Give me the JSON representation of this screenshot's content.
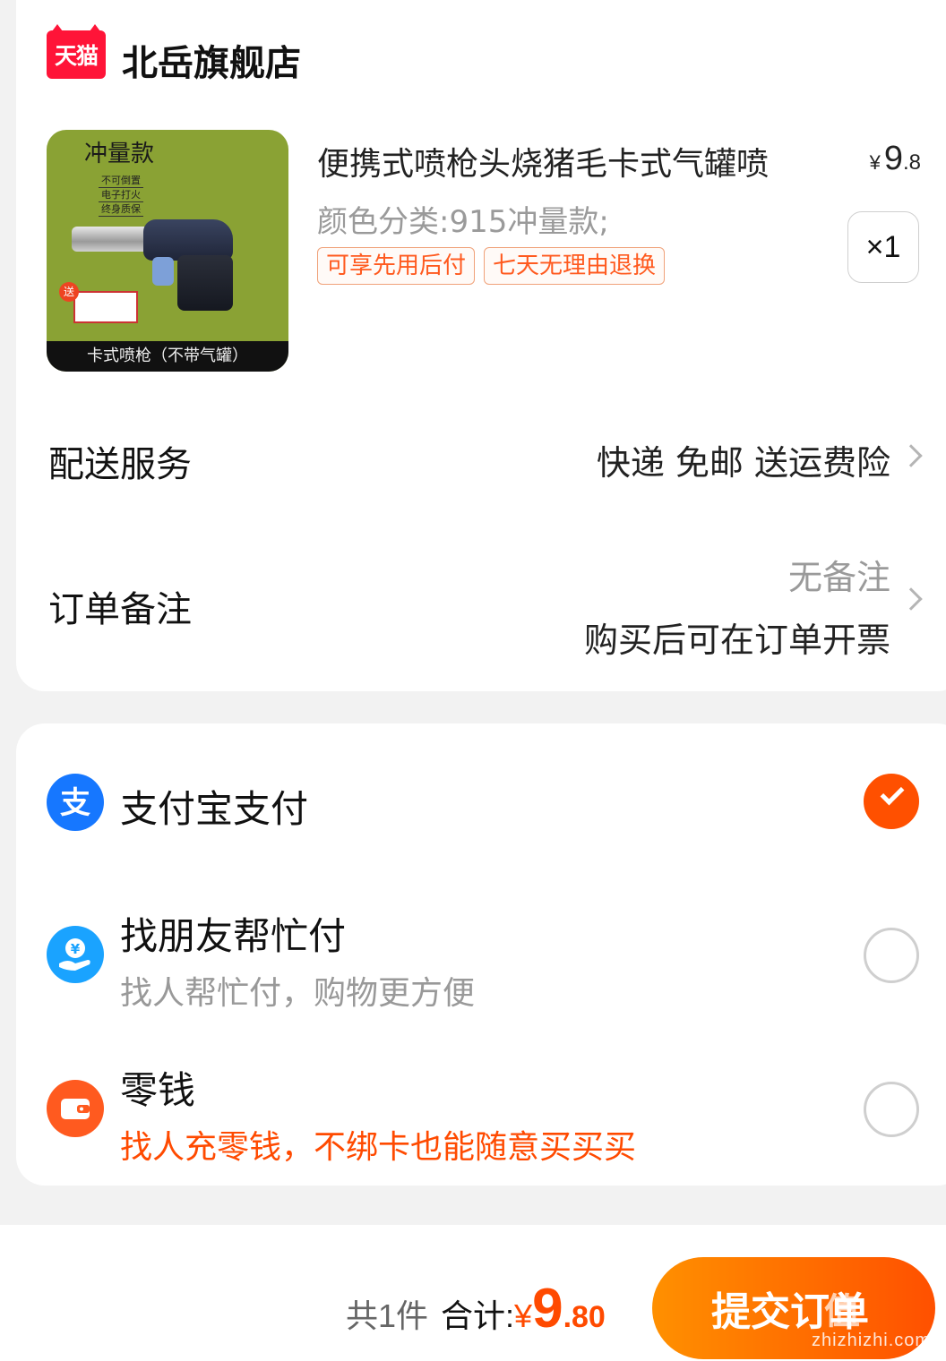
{
  "store": {
    "badge": "天猫",
    "name": "北岳旗舰店"
  },
  "product": {
    "image": {
      "title": "冲量款",
      "notes": [
        "不可倒置",
        "电子打火",
        "终身质保"
      ],
      "gift_tag": "送",
      "caption": "卡式喷枪（不带气罐）"
    },
    "title": "便携式喷枪头烧猪毛卡式气罐喷",
    "price_currency": "¥",
    "price_int": "9",
    "price_dec": ".8",
    "spec": "颜色分类:915冲量款;",
    "tags": [
      "可享先用后付",
      "七天无理由退换"
    ],
    "quantity": "×1"
  },
  "delivery": {
    "label": "配送服务",
    "value": "快递 免邮 送运费险"
  },
  "remark": {
    "label": "订单备注",
    "value": "无备注",
    "sub": "购买后可在订单开票"
  },
  "payment": {
    "options": [
      {
        "title": "支付宝支付",
        "sub": "",
        "icon": "alipay-icon",
        "color": "#1677ff",
        "selected": true
      },
      {
        "title": "找朋友帮忙付",
        "sub": "找人帮忙付，购物更方便",
        "icon": "friend-pay-icon",
        "color": "#1aa3ff",
        "selected": false
      },
      {
        "title": "零钱",
        "sub": "找人充零钱，不绑卡也能随意买买买",
        "icon": "wallet-icon",
        "color": "#ff5a1f",
        "selected": false
      }
    ]
  },
  "footer": {
    "count": "共1件",
    "total_label": "合计:",
    "currency": "¥",
    "amount_int": "9",
    "amount_dec": ".80",
    "submit": "提交订单",
    "watermark_mark": "值",
    "watermark": "zhizhizhi.com"
  },
  "colors": {
    "accent": "#ff5000",
    "tmall": "#ff1438",
    "alipay": "#1677ff"
  }
}
